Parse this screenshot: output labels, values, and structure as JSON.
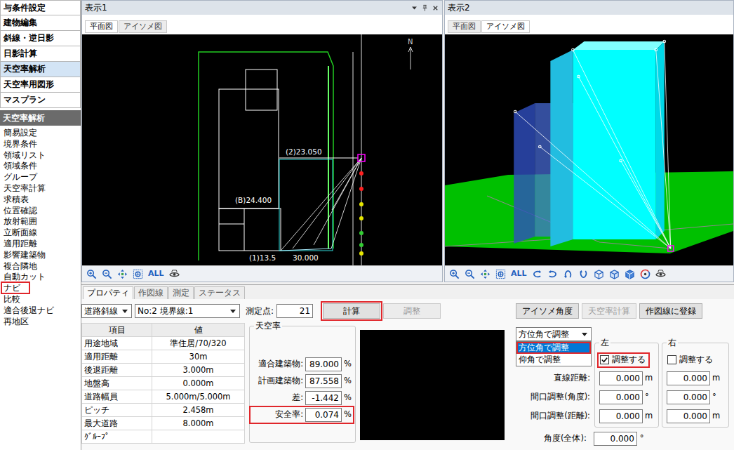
{
  "sidebar": {
    "menu": [
      {
        "label": "与条件設定",
        "selected": false
      },
      {
        "label": "建物編集",
        "selected": false
      },
      {
        "label": "斜線・逆日影",
        "selected": false
      },
      {
        "label": "日影計算",
        "selected": false
      },
      {
        "label": "天空率解析",
        "selected": true
      },
      {
        "label": "天空率用図形",
        "selected": false
      },
      {
        "label": "マスプラン",
        "selected": false
      }
    ],
    "section": "天空率解析",
    "items": [
      {
        "label": "簡易設定",
        "highlighted": false
      },
      {
        "label": "境界条件",
        "highlighted": false
      },
      {
        "label": "領域リスト",
        "highlighted": false
      },
      {
        "label": "領域条件",
        "highlighted": false
      },
      {
        "label": "グループ",
        "highlighted": false
      },
      {
        "label": "天空率計算",
        "highlighted": false
      },
      {
        "label": "求積表",
        "highlighted": false
      },
      {
        "label": "位置確認",
        "highlighted": false
      },
      {
        "label": "放射範囲",
        "highlighted": false
      },
      {
        "label": "立断面線",
        "highlighted": false
      },
      {
        "label": "適用距離",
        "highlighted": false
      },
      {
        "label": "影響建築物",
        "highlighted": false
      },
      {
        "label": "複合隣地",
        "highlighted": false
      },
      {
        "label": "自動カット",
        "highlighted": false
      },
      {
        "label": "ナビ",
        "highlighted": true
      },
      {
        "label": "比較",
        "highlighted": false
      },
      {
        "label": "適合後退ナビ",
        "highlighted": false
      },
      {
        "label": "再地区",
        "highlighted": false
      }
    ]
  },
  "views": [
    {
      "title": "表示1",
      "tabs": [
        {
          "label": "平面図",
          "selected": true
        },
        {
          "label": "アイソメ図",
          "selected": false
        }
      ],
      "toolbar_text": "ALL"
    },
    {
      "title": "表示2",
      "tabs": [
        {
          "label": "平面図",
          "selected": false
        },
        {
          "label": "アイソメ図",
          "selected": true
        }
      ],
      "toolbar_text": "ALL"
    }
  ],
  "plan": {
    "north": "N",
    "labels": [
      "(2)23.050",
      "(B)24.400",
      "(1)13.5",
      "30.000"
    ],
    "points": [
      {
        "color": "#ff2020"
      },
      {
        "color": "#ff2020"
      },
      {
        "color": "#e6e600"
      },
      {
        "color": "#e6e600"
      },
      {
        "color": "#33cc33"
      },
      {
        "color": "#33cc33"
      },
      {
        "color": "#e6e600"
      }
    ]
  },
  "panel": {
    "tabs": [
      {
        "label": "プロパティ",
        "selected": true
      },
      {
        "label": "作図線",
        "selected": false
      },
      {
        "label": "測定",
        "selected": false
      },
      {
        "label": "ステータス",
        "selected": false
      }
    ],
    "kind_select": "道路斜線",
    "boundary_select": "No:2 境界線:1",
    "point_label": "測定点:",
    "point_value": "21",
    "actions": [
      {
        "label": "計算",
        "disabled": false,
        "highlighted": true
      },
      {
        "label": "調整",
        "disabled": true,
        "highlighted": false
      }
    ],
    "view_actions": [
      {
        "label": "アイソメ角度",
        "disabled": false
      },
      {
        "label": "天空率計算",
        "disabled": true
      },
      {
        "label": "作図線に登録",
        "disabled": false
      }
    ],
    "table": {
      "columns": [
        "項目",
        "値"
      ],
      "rows": [
        [
          "用途地域",
          "準住居/70/320"
        ],
        [
          "適用距離",
          "30m"
        ],
        [
          "後退距離",
          "3.000m"
        ],
        [
          "地盤高",
          "0.000m"
        ],
        [
          "道路幅員",
          "5.000m/5.000m"
        ],
        [
          "ピッチ",
          "2.458m"
        ],
        [
          "最大道路",
          "8.000m"
        ],
        [
          "ｸﾞﾙｰﾌﾟ",
          ""
        ]
      ]
    },
    "sky": {
      "title": "天空率",
      "rows": [
        {
          "label": "適合建築物:",
          "value": "89.000",
          "unit": "%",
          "highlighted": false
        },
        {
          "label": "計画建築物:",
          "value": "87.558",
          "unit": "%",
          "highlighted": false
        },
        {
          "label": "差:",
          "value": "-1.442",
          "unit": "%",
          "highlighted": false
        },
        {
          "label": "安全率:",
          "value": "0.074",
          "unit": "%",
          "highlighted": true
        }
      ]
    },
    "adjust": {
      "mode": {
        "value": "方位角で調整",
        "expanded": true,
        "options": [
          {
            "label": "方位角で調整",
            "selected": true,
            "highlighted": true
          },
          {
            "label": "仰角で調整",
            "selected": false,
            "highlighted": false
          }
        ]
      },
      "sides": [
        {
          "title": "左",
          "label": "調整する",
          "checked": true,
          "highlighted": true
        },
        {
          "title": "右",
          "label": "調整する",
          "checked": false,
          "highlighted": false
        }
      ],
      "rows": [
        {
          "label": "直線距離:",
          "values": [
            "0.000",
            "0.000"
          ],
          "unit": "m"
        },
        {
          "label": "間口調整(角度):",
          "values": [
            "0.000",
            "0.000"
          ],
          "unit": "°"
        },
        {
          "label": "間口調整(距離):",
          "values": [
            "0.000",
            "0.000"
          ],
          "unit": "m"
        }
      ],
      "total": {
        "label": "角度(全体):",
        "value": "0.000",
        "unit": "°"
      }
    }
  }
}
